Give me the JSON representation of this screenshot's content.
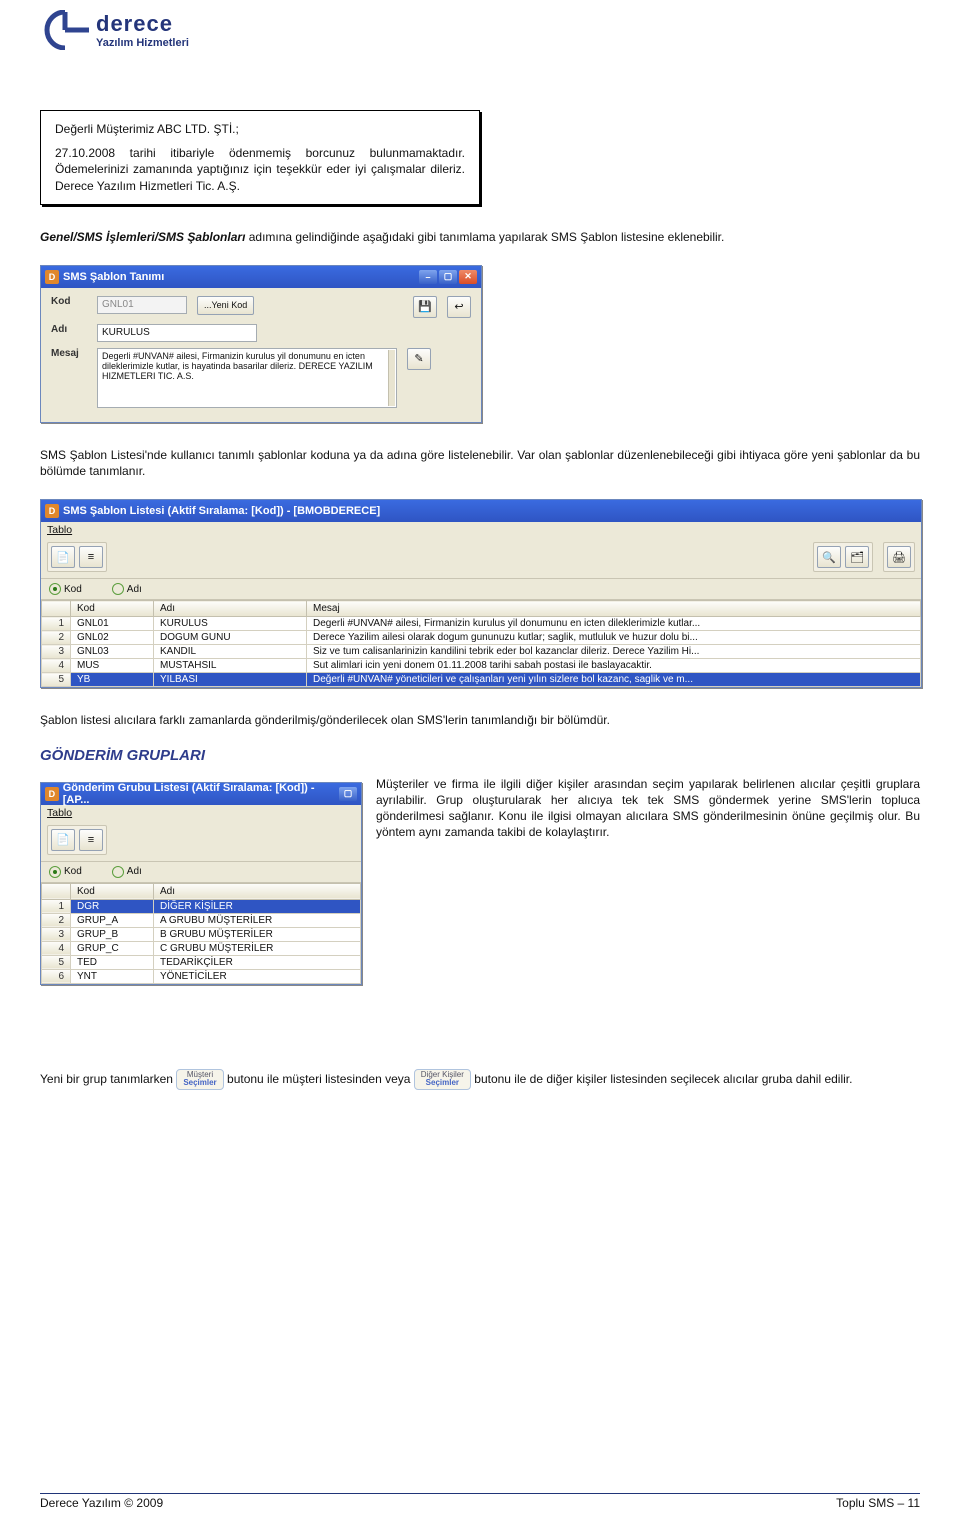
{
  "logo": {
    "brand": "derece",
    "sub": "Yazılım Hizmetleri"
  },
  "message_box": {
    "greeting": "Değerli Müşterimiz ABC LTD. ŞTİ.;",
    "body": "27.10.2008 tarihi itibariyle ödenmemiş borcunuz bulunmamaktadır. Ödemelerinizi zamanında yaptığınız için teşekkür eder iyi çalışmalar dileriz. Derece Yazılım Hizmetleri Tic. A.Ş."
  },
  "intro_para": {
    "bold": "Genel/SMS İşlemleri/SMS Şablonları",
    "rest": " adımına gelindiğinde aşağıdaki gibi tanımlama yapılarak SMS Şablon listesine eklenebilir."
  },
  "def_window": {
    "title": "SMS Şablon Tanımı",
    "labels": {
      "kod": "Kod",
      "adi": "Adı",
      "mesaj": "Mesaj"
    },
    "values": {
      "kod": "GNL01",
      "yeni_kod_btn": "...Yeni Kod",
      "adi": "KURULUS",
      "mesaj": "Degerli #UNVAN# ailesi, Firmanizin kurulus yil donumunu en icten dileklerimizle kutlar, is hayatinda basarilar dileriz. DERECE YAZILIM HIZMETLERI TIC. A.S."
    }
  },
  "mid_para": "SMS Şablon Listesi'nde kullanıcı tanımlı şablonlar koduna ya da adına göre listelenebilir. Var olan şablonlar düzenlenebileceği gibi ihtiyaca göre yeni şablonlar da bu bölümde tanımlanır.",
  "list_window": {
    "title": "SMS Şablon Listesi (Aktif Sıralama: [Kod]) - [BMOBDERECE]",
    "menu": "Tablo",
    "radios": {
      "kod": "Kod",
      "adi": "Adı"
    },
    "cols": {
      "kod": "Kod",
      "adi": "Adı",
      "mesaj": "Mesaj"
    },
    "rows": [
      {
        "n": "1",
        "kod": "GNL01",
        "adi": "KURULUS",
        "mesaj": "Degerli #UNVAN# ailesi, Firmanizin kurulus yil donumunu en icten dileklerimizle kutlar..."
      },
      {
        "n": "2",
        "kod": "GNL02",
        "adi": "DOGUM GUNU",
        "mesaj": "Derece Yazilim ailesi olarak dogum gununuzu kutlar; saglik, mutluluk ve huzur dolu bi..."
      },
      {
        "n": "3",
        "kod": "GNL03",
        "adi": "KANDIL",
        "mesaj": "Siz ve tum calisanlarinizin kandilini tebrik eder bol kazanclar dileriz. Derece Yazilim Hi..."
      },
      {
        "n": "4",
        "kod": "MUS",
        "adi": "MUSTAHSIL",
        "mesaj": "Sut alimlari icin yeni donem 01.11.2008 tarihi sabah postasi ile baslayacaktir."
      },
      {
        "n": "5",
        "kod": "YB",
        "adi": "YILBASI",
        "mesaj": "Değerli #UNVAN# yöneticileri ve çalışanları yeni yılın sizlere bol kazanc, saglik ve m..."
      }
    ]
  },
  "after_list_para": "Şablon listesi alıcılara farklı zamanlarda gönderilmiş/gönderilecek olan SMS'lerin tanımlandığı bir bölümdür.",
  "gonderim": {
    "title": "GÖNDERİM GRUPLARI",
    "window": {
      "title": "Gönderim Grubu Listesi (Aktif Sıralama: [Kod]) - [AP...",
      "menu": "Tablo",
      "radios": {
        "kod": "Kod",
        "adi": "Adı"
      },
      "cols": {
        "kod": "Kod",
        "adi": "Adı"
      },
      "rows": [
        {
          "n": "1",
          "kod": "DGR",
          "adi": "DİĞER KİŞİLER"
        },
        {
          "n": "2",
          "kod": "GRUP_A",
          "adi": "A GRUBU MÜŞTERİLER"
        },
        {
          "n": "3",
          "kod": "GRUP_B",
          "adi": "B GRUBU MÜŞTERİLER"
        },
        {
          "n": "4",
          "kod": "GRUP_C",
          "adi": "C GRUBU MÜŞTERİLER"
        },
        {
          "n": "5",
          "kod": "TED",
          "adi": "TEDARİKÇİLER"
        },
        {
          "n": "6",
          "kod": "YNT",
          "adi": "YÖNETİCİLER"
        }
      ]
    },
    "right_text": "Müşteriler ve firma ile ilgili diğer kişiler arasından seçim yapılarak belirlenen alıcılar çeşitli gruplara ayrılabilir. Grup oluşturularak her alıcıya tek tek SMS göndermek yerine SMS'lerin topluca gönderilmesi sağlanır. Konu ile ilgisi olmayan alıcılara SMS gönderilmesinin önüne geçilmiş olur. Bu yöntem aynı zamanda takibi de kolaylaştırır."
  },
  "inline_buttons": {
    "musteri": {
      "top": "Müşteri",
      "bottom": "Seçimler"
    },
    "diger": {
      "top": "Diğer Kişiler",
      "bottom": "Seçimler"
    }
  },
  "bottom_para": {
    "p1": "Yeni bir grup tanımlarken ",
    "p2": " butonu ile müşteri listesinden veya ",
    "p3": " butonu ile de diğer kişiler listesinden seçilecek alıcılar gruba dahil edilir."
  },
  "footer": {
    "left": "Derece Yazılım © 2009",
    "right": "Toplu SMS – 11"
  }
}
